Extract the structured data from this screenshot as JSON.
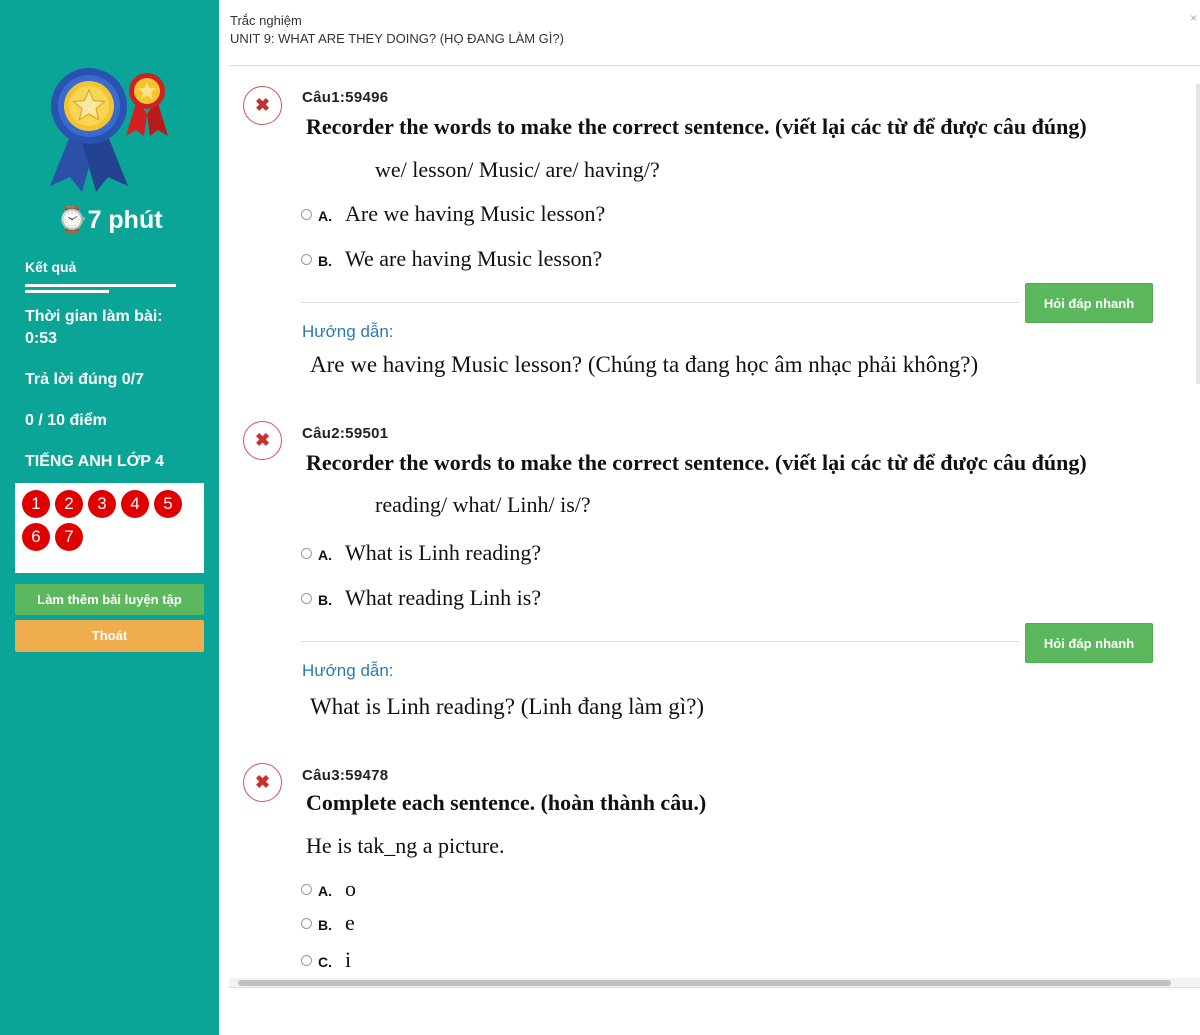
{
  "header": {
    "subtitle": "Trắc nghiệm",
    "title": "UNIT 9: WHAT ARE THEY DOING? (HỌ ĐANG LÀM GÌ?)",
    "close": "×"
  },
  "sidebar": {
    "timer": "⌚7 phút",
    "result_label": "Kết quả",
    "time_label": "Thời gian làm bài:",
    "time_value": "0:53",
    "correct": "Trả lời đúng 0/7",
    "score": "0 / 10 điểm",
    "subject": "TIẾNG ANH LỚP 4",
    "question_numbers": [
      "1",
      "2",
      "3",
      "4",
      "5",
      "6",
      "7"
    ],
    "more_practice": "Làm thêm bài luyện tập",
    "exit": "Thoát"
  },
  "colors": {
    "sidebar": "#0aa596",
    "wrong": "#e00000",
    "primary_button": "#5cb85c",
    "exit_button": "#f0ad4e",
    "guide_label": "#2a7ab5"
  },
  "questions": [
    {
      "id": "Câu1:59496",
      "status_icon": "✖",
      "prompt": "Recorder the words  to make the correct sentence. (viết lại các từ để được câu đúng)",
      "words": "we/ lesson/ Music/ are/ having/?",
      "options": [
        {
          "letter": "A.",
          "text": "Are we having Music lesson?"
        },
        {
          "letter": "B.",
          "text": "We are having Music lesson?"
        }
      ],
      "qa_button": "Hỏi đáp nhanh",
      "guide_label": "Hướng dẫn:",
      "guide_text": "Are we having Music lesson? (Chúng ta đang học âm nhạc phải không?)"
    },
    {
      "id": "Câu2:59501",
      "status_icon": "✖",
      "prompt": "Recorder the words  to make the correct sentence. (viết lại các từ để được câu đúng)",
      "words": "reading/ what/ Linh/ is/?",
      "options": [
        {
          "letter": "A.",
          "text": "What is Linh reading?"
        },
        {
          "letter": "B.",
          "text": "What reading Linh is?"
        }
      ],
      "qa_button": "Hỏi đáp nhanh",
      "guide_label": "Hướng dẫn:",
      "guide_text": "What is Linh reading? (Linh đang làm gì?)"
    },
    {
      "id": "Câu3:59478",
      "status_icon": "✖",
      "prompt": "Complete each sentence. (hoàn thành câu.)",
      "sentence": "He is tak_ng a picture.",
      "options": [
        {
          "letter": "A.",
          "text": "o"
        },
        {
          "letter": "B.",
          "text": "e"
        },
        {
          "letter": "C.",
          "text": "i"
        }
      ]
    }
  ]
}
